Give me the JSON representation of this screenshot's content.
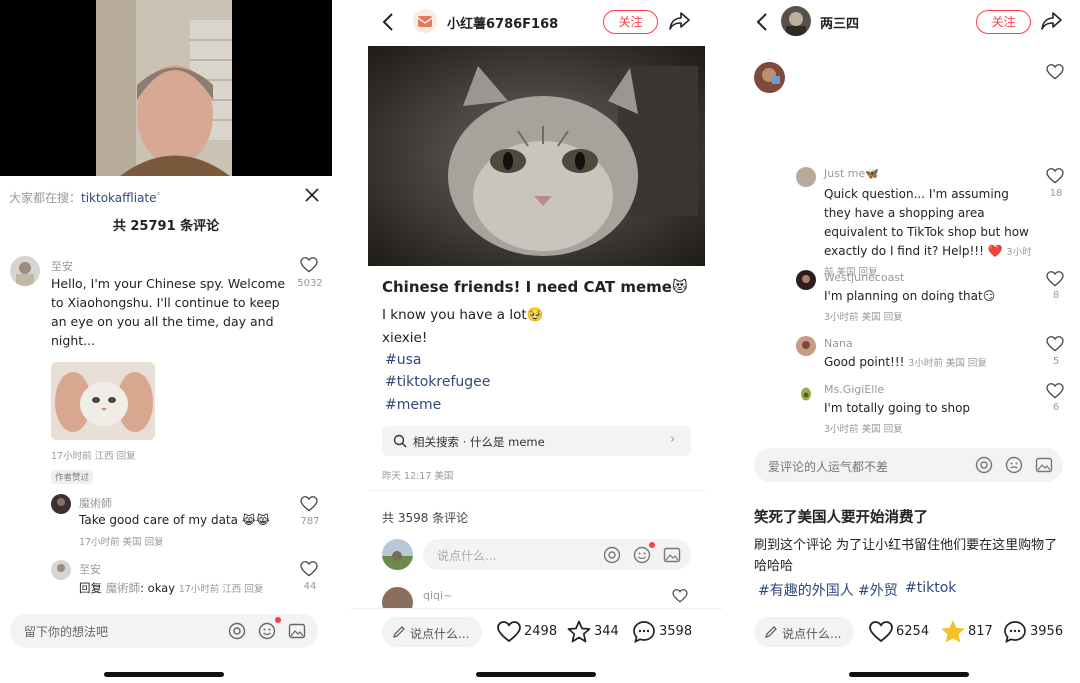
{
  "panel1": {
    "search_prefix": "大家都在搜：",
    "search_term": "tiktokaffliate",
    "comment_count_title": "共 25791 条评论",
    "comments": [
      {
        "user": "至安",
        "text": "Hello, I'm your Chinese spy. Welcome to Xiaohongshu. I'll continue to keep an eye on you all the time, day and night...",
        "meta": "17小时前 江西 回复",
        "badge": "作者赞过",
        "likes": "5032"
      }
    ],
    "replies": [
      {
        "user": "魔術師",
        "text": "Take good care of my data",
        "meta": "17小时前 美国 回复",
        "likes": "787"
      },
      {
        "user": "至安",
        "text_prefix": "回复",
        "reply_to": "魔術師",
        "text": ": okay",
        "meta": "17小时前 江西 回复",
        "likes": "44"
      }
    ],
    "input_placeholder": "留下你的想法吧"
  },
  "panel2": {
    "username": "小红薯6786F168",
    "follow_label": "关注",
    "post_title": "Chinese friends! I need CAT meme",
    "body_line1": "I know you have a lot",
    "body_line2": "xiexie!",
    "tags": [
      "#usa",
      "#tiktokrefugee",
      "#meme"
    ],
    "related_search": "相关搜索 · 什么是 meme",
    "post_time": "昨天 12:17 美国",
    "comment_count_title": "共 3598 条评论",
    "comment_input_placeholder": "说点什么...",
    "partial_comment_user": "qiqi~",
    "bottom_input": "说点什么...",
    "likes": "2498",
    "stars": "344",
    "comments": "3598"
  },
  "panel3": {
    "username": "两三四",
    "follow_label": "关注",
    "comments": "3956",
    "replies": [
      {
        "user": "Just me",
        "text": "Quick question... I'm assuming they have a shopping area equivalent to TikTok shop but how exactly do I find it? Help!!!",
        "meta": "3小时前 美国 回复",
        "likes": "18"
      },
      {
        "user": "Westjunecoast",
        "text": "I'm planning on doing that",
        "meta": "3小时前 美国 回复",
        "likes": "8"
      },
      {
        "user": "Nana",
        "text": "Good point!!!",
        "meta": "3小时前 美国 回复",
        "likes": "5"
      },
      {
        "user": "Ms.GigiElle",
        "text": "I'm totally going to shop",
        "meta": "3小时前 美国 回复",
        "likes": "6"
      }
    ],
    "comment_input_placeholder": "爱评论的人运气都不差",
    "post_title": "笑死了美国人要开始消费了",
    "post_body": "刷到这个评论 为了让小红书留住他们要在这里购物了哈哈哈",
    "tags": [
      "#有趣的外国人",
      "#外贸",
      "#tiktok"
    ],
    "bottom_input": "说点什么...",
    "likes": "6254",
    "stars": "817"
  },
  "colors": {
    "accent_red": "#ff3b4e",
    "link_blue": "#2f4a7a",
    "star_gold": "#f5c028"
  }
}
